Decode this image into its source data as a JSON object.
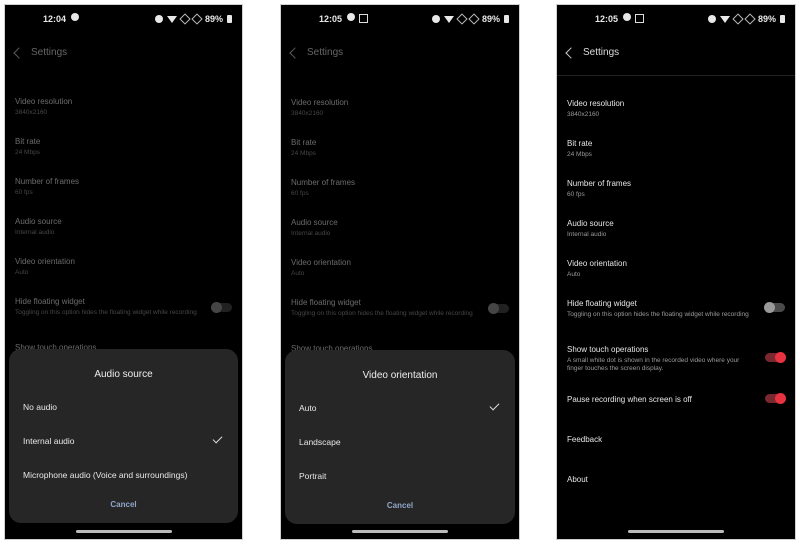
{
  "settings": {
    "title": "Settings",
    "items": [
      {
        "label": "Video resolution",
        "sub": "3840x2160"
      },
      {
        "label": "Bit rate",
        "sub": "24 Mbps"
      },
      {
        "label": "Number of frames",
        "sub": "60 fps"
      },
      {
        "label": "Audio source",
        "sub": "Internal audio"
      },
      {
        "label": "Video orientation",
        "sub": "Auto"
      }
    ],
    "hide_widget": {
      "label": "Hide floating widget",
      "sub": "Toggling on this option hides the floating widget while recording",
      "on": false
    },
    "show_touch": {
      "label": "Show touch operations",
      "sub": "A small white dot is shown in the recorded video where your finger touches the screen display.",
      "on": true
    },
    "pause": {
      "label": "Pause recording when screen is off",
      "on": true
    },
    "feedback": "Feedback",
    "about": "About"
  },
  "screens": [
    {
      "time": "12:04",
      "battery": "89%"
    },
    {
      "time": "12:05",
      "battery": "89%"
    },
    {
      "time": "12:05",
      "battery": "89%"
    }
  ],
  "audio_dialog": {
    "title": "Audio source",
    "options": [
      "No audio",
      "Internal audio",
      "Microphone audio (Voice and surroundings)"
    ],
    "selected": "Internal audio",
    "cancel": "Cancel"
  },
  "orientation_dialog": {
    "title": "Video orientation",
    "options": [
      "Auto",
      "Landscape",
      "Portrait"
    ],
    "selected": "Auto",
    "cancel": "Cancel"
  },
  "colors": {
    "accent": "#e8323f",
    "cancel": "#8fa6c8",
    "background": "#000000",
    "sheet": "#262626"
  }
}
